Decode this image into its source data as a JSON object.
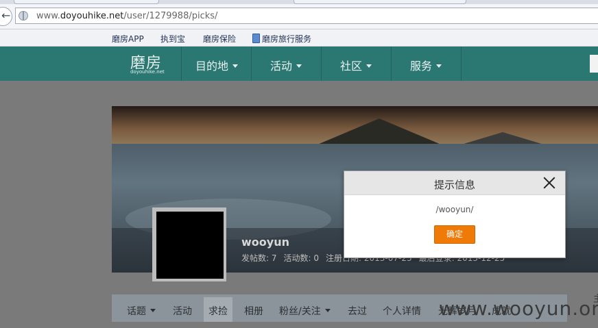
{
  "browser": {
    "url_prefix": "www.",
    "url_domain": "doyouhike.net",
    "url_path": "/user/1279988/picks/",
    "back_glyph": "←"
  },
  "bookmarks": [
    {
      "label": "磨房APP"
    },
    {
      "label": "执到宝"
    },
    {
      "label": "磨房保险"
    },
    {
      "label": "磨房旅行服务"
    }
  ],
  "header": {
    "logo_cn": "磨房",
    "logo_en": "doyouhike.net",
    "nav": [
      {
        "label": "目的地"
      },
      {
        "label": "活动"
      },
      {
        "label": "社区"
      },
      {
        "label": "服务"
      }
    ]
  },
  "profile": {
    "username": "wooyun",
    "stats": [
      "发帖数: 7",
      "活动数: 0",
      "注册日期: 2013-07-23",
      "最后登录: 2013-12-25"
    ]
  },
  "tabs": [
    {
      "label": "话题",
      "dropdown": true
    },
    {
      "label": "活动",
      "dropdown": false
    },
    {
      "label": "求捡",
      "dropdown": false,
      "active": true
    },
    {
      "label": "相册",
      "dropdown": false
    },
    {
      "label": "粉丝/关注",
      "dropdown": true
    },
    {
      "label": "去过",
      "dropdown": false
    },
    {
      "label": "个人详情",
      "dropdown": false
    },
    {
      "label": "光辉岁月",
      "dropdown": false
    },
    {
      "label": "成就",
      "dropdown": false
    }
  ],
  "side_glyph": "主",
  "watermark": "www.wooyun.org",
  "dialog": {
    "title": "提示信息",
    "message": "/wooyun/",
    "confirm_label": "确定"
  },
  "colors": {
    "header_bg": "#2b7873",
    "confirm_button": "#f07a08"
  }
}
